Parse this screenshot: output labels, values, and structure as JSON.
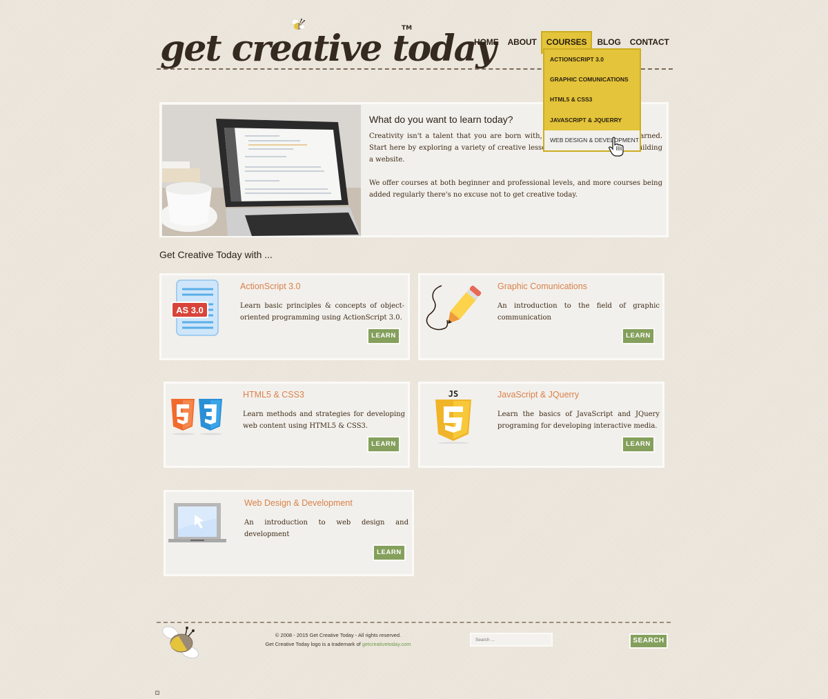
{
  "logo": {
    "text": "get creative today",
    "tm": "TM"
  },
  "nav": {
    "items": [
      {
        "label": "HOME",
        "active": false
      },
      {
        "label": "ABOUT",
        "active": false
      },
      {
        "label": "COURSES",
        "active": true
      },
      {
        "label": "BLOG",
        "active": false
      },
      {
        "label": "CONTACT",
        "active": false
      }
    ],
    "dropdown": [
      {
        "label": "ACTIONSCRIPT 3.0",
        "hover": false
      },
      {
        "label": "GRAPHIC COMUNICATIONS",
        "hover": false
      },
      {
        "label": "HTML5 & CSS3",
        "hover": false
      },
      {
        "label": "JAVASCRIPT & JQUERRY",
        "hover": false
      },
      {
        "label": "WEB DESIGN & DEVELOPMENT",
        "hover": true
      }
    ]
  },
  "hero": {
    "title": "What do you want to learn today?",
    "paragraph1": "Creativity isn't a talent that you are born with, it is a skill that can be learned. Start here by exploring a variety of creative lessons from simple crafts to building a website.",
    "paragraph2": "We offer courses at both beginner and professional levels, and more courses being added regularly there's no excuse not to get creative today.",
    "image_alt": "laptop-with-code-and-coffee-cup"
  },
  "section_title": "Get Creative Today with ...",
  "courses": [
    {
      "title": "ActionScript 3.0",
      "description": "Learn basic principles & concepts of object-oriented programming using ActionScript 3.0.",
      "button": "LEARN",
      "icon": "as3-document-icon",
      "icon_label": "AS 3.0"
    },
    {
      "title": "Graphic Comunications",
      "description": "An introduction to the field of graphic communication",
      "button": "LEARN",
      "icon": "pencil-icon"
    },
    {
      "title": "HTML5 & CSS3",
      "description": "Learn methods and strategies for developing web content using HTML5 & CSS3.",
      "button": "LEARN",
      "icon": "html5-css3-shields-icon"
    },
    {
      "title": "JavaScript & JQuerry",
      "description": "Learn the basics of JavaScript and JQuery programing for developing interactive media.",
      "button": "LEARN",
      "icon": "js-shield-icon",
      "icon_label": "JS"
    },
    {
      "title": "Web Design & Development",
      "description": "An introduction to web design and development",
      "button": "LEARN",
      "icon": "laptop-cursor-icon"
    }
  ],
  "footer": {
    "copyright": "© 2008 - 2015 Get Creative Today - All rights reserved.",
    "trademark_prefix": "Get Creative Today logo is a trademark of ",
    "trademark_link": "getcreativetoday.com",
    "search_placeholder": "Search ...",
    "search_button": "SEARCH"
  },
  "colors": {
    "accent_yellow": "#e3c43a",
    "button_green": "#84a05c",
    "title_orange": "#d9814a",
    "link_green": "#6f9a4a"
  }
}
